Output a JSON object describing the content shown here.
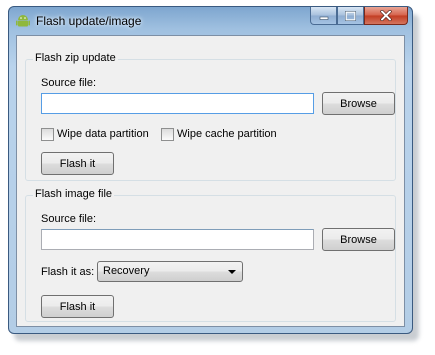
{
  "window": {
    "title": "Flash update/image",
    "icon": "android-icon"
  },
  "zip_group": {
    "title": "Flash zip update",
    "source_label": "Source file:",
    "source_value": "",
    "browse_label": "Browse",
    "wipe_data_label": "Wipe data partition",
    "wipe_data_checked": false,
    "wipe_cache_label": "Wipe cache partition",
    "wipe_cache_checked": false,
    "flash_label": "Flash it"
  },
  "image_group": {
    "title": "Flash image file",
    "source_label": "Source file:",
    "source_value": "",
    "browse_label": "Browse",
    "flash_as_label": "Flash it as:",
    "flash_as_selected": "Recovery",
    "flash_label": "Flash it"
  },
  "colors": {
    "accent": "#569de5",
    "close_button": "#c23c22"
  }
}
